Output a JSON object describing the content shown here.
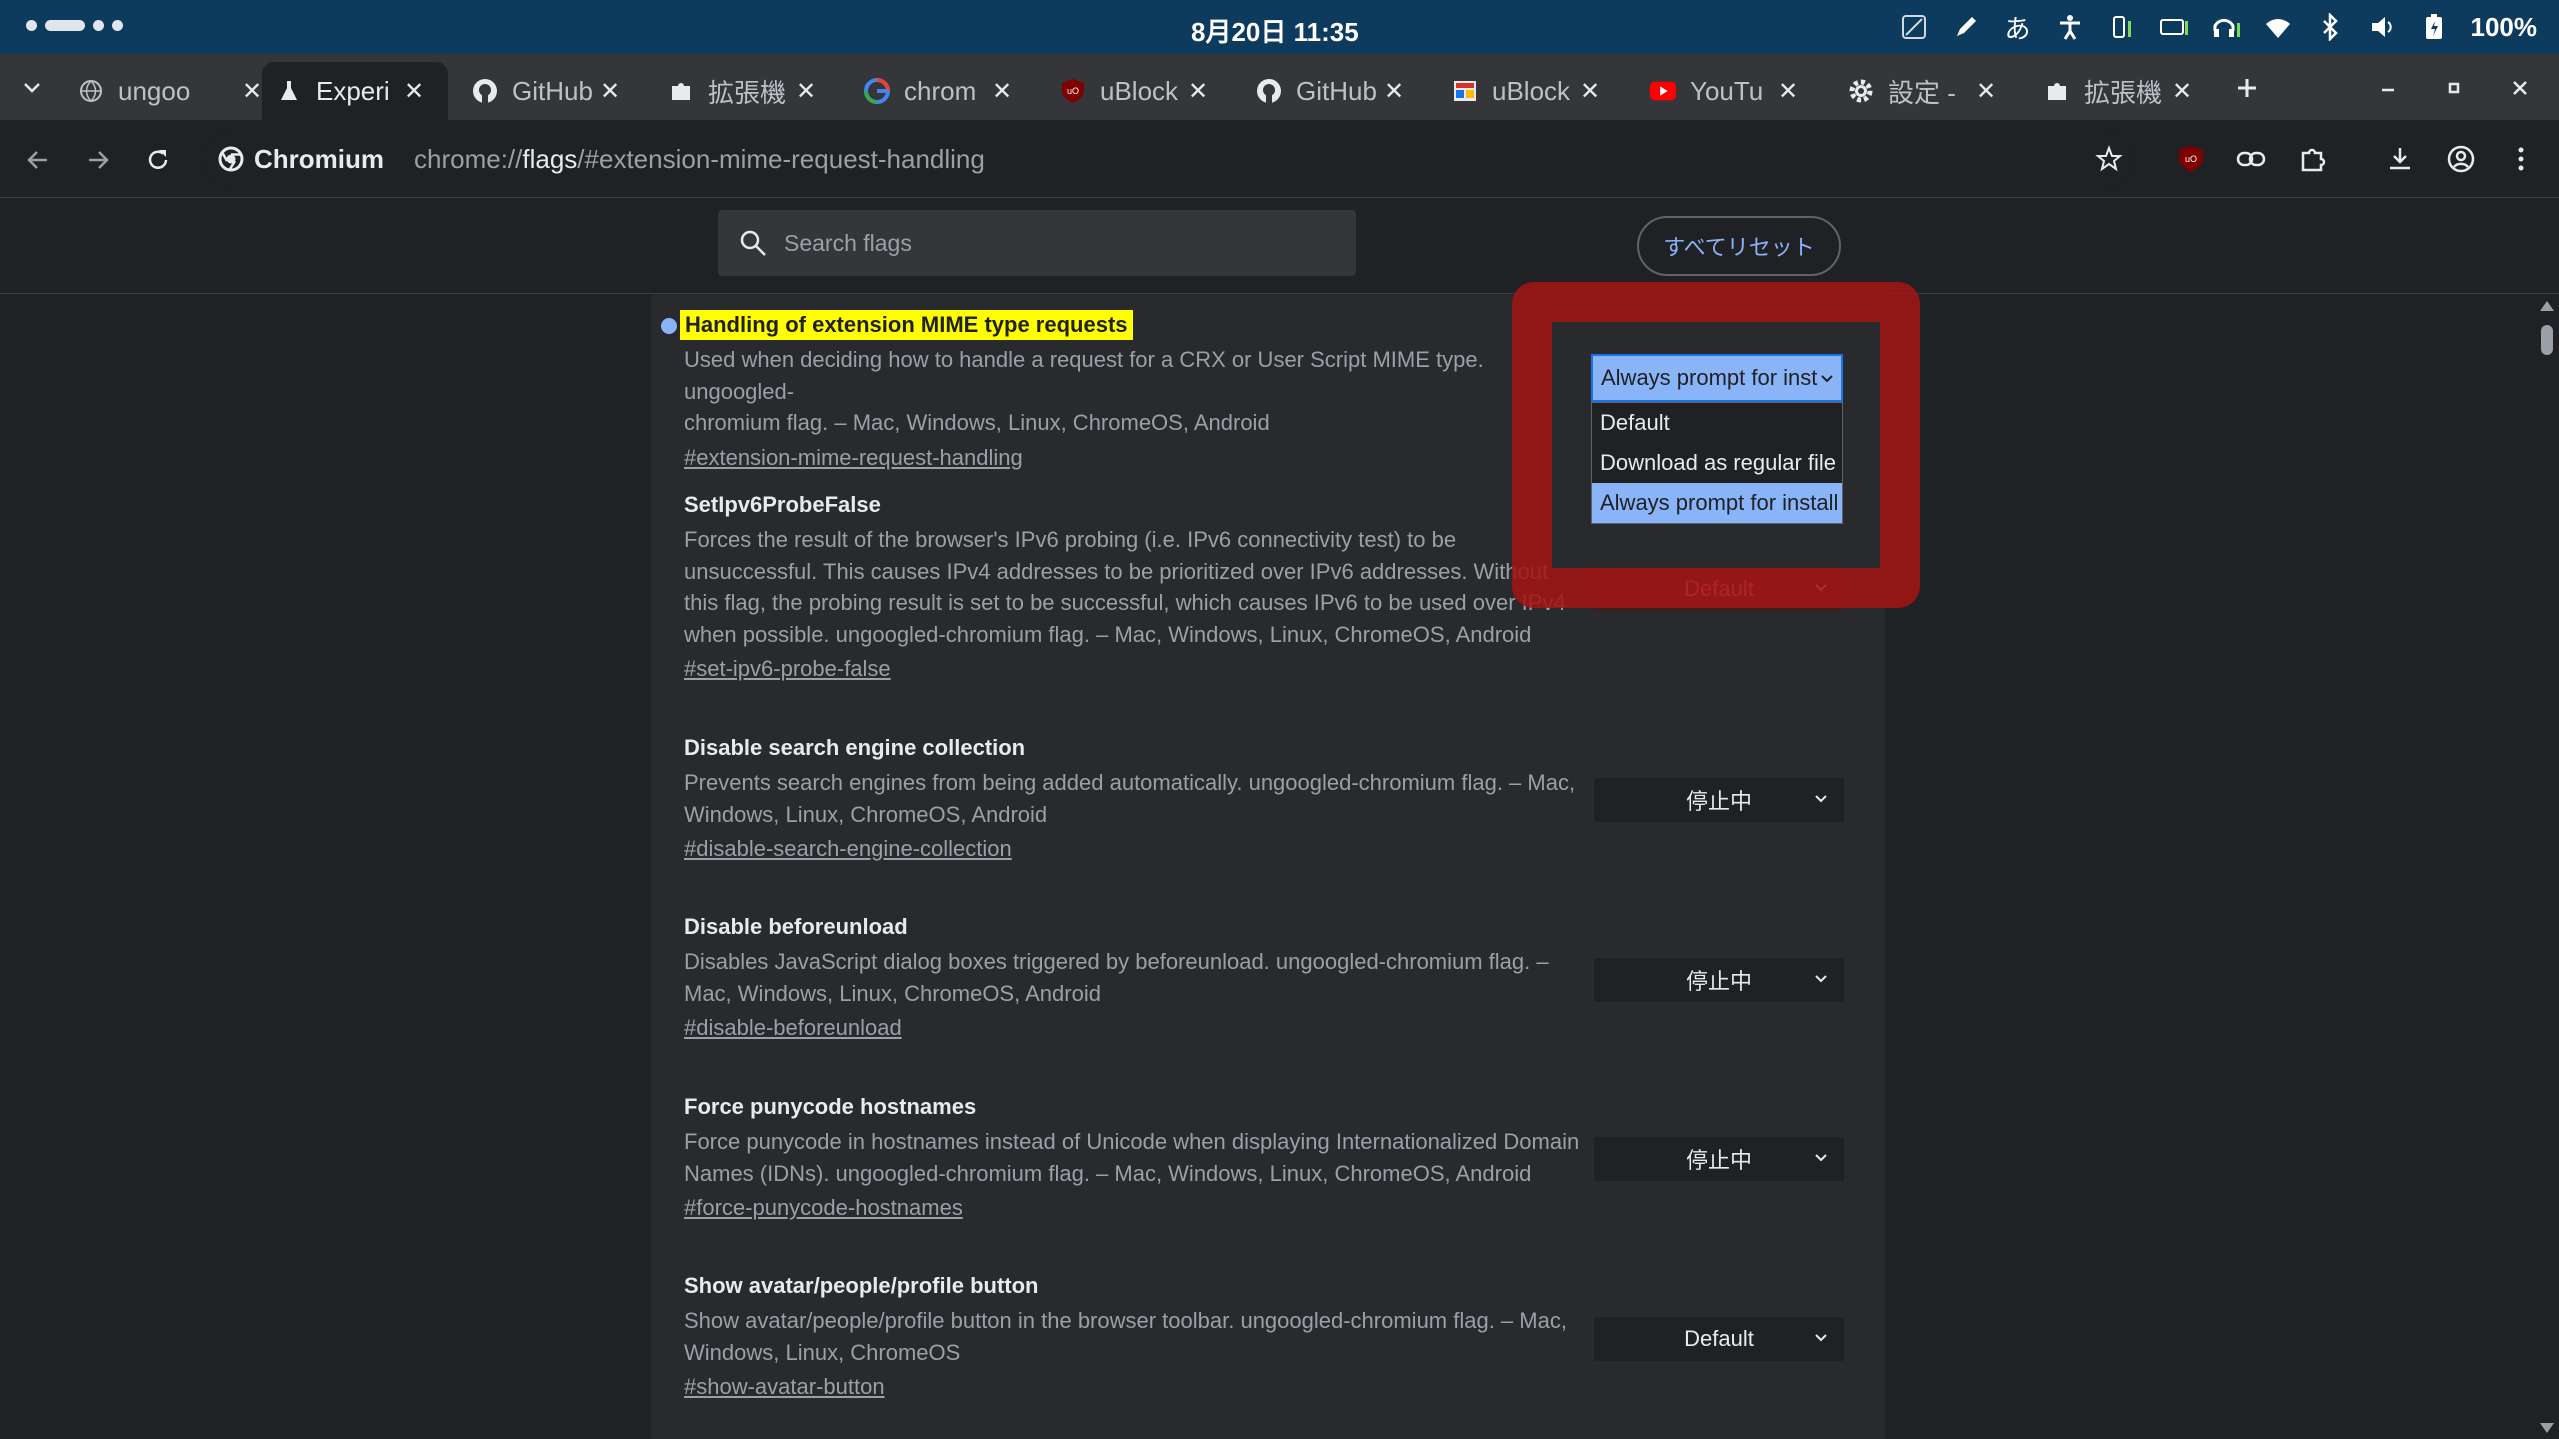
{
  "status_bar": {
    "clock": "8月20日 11:35",
    "battery": "100%",
    "ime": "あ"
  },
  "tabs": [
    {
      "title": "ungoo",
      "icon": "globe-icon"
    },
    {
      "title": "Experi",
      "icon": "flask-icon",
      "active": true
    },
    {
      "title": "GitHub",
      "icon": "github-icon"
    },
    {
      "title": "拡張機",
      "icon": "puzzle-icon"
    },
    {
      "title": "chrom",
      "icon": "google-icon"
    },
    {
      "title": "uBlock",
      "icon": "ublock-icon"
    },
    {
      "title": "GitHub",
      "icon": "github-icon"
    },
    {
      "title": "uBlock",
      "icon": "page-icon"
    },
    {
      "title": "YouTu",
      "icon": "youtube-icon"
    },
    {
      "title": "設定 -",
      "icon": "gear-icon"
    },
    {
      "title": "拡張機",
      "icon": "puzzle-icon"
    }
  ],
  "omnibox": {
    "chip": "Chromium",
    "url_prefix": "chrome://",
    "url_host": "flags",
    "url_rest": "/#extension-mime-request-handling"
  },
  "header": {
    "search_placeholder": "Search flags",
    "reset_label": "すべてリセット"
  },
  "flags": [
    {
      "title": "Handling of extension MIME type requests",
      "desc_lines": [
        "Used when deciding how to handle a request for a CRX or User Script MIME type. ungoogled-",
        "chromium flag. – Mac, Windows, Linux, ChromeOS, Android"
      ],
      "link": "#extension-mime-request-handling",
      "value": "Always prompt for inst"
    },
    {
      "title": "SetIpv6ProbeFalse",
      "desc_lines": [
        "Forces the result of the browser's IPv6 probing (i.e. IPv6 connectivity test) to be",
        "unsuccessful. This causes IPv4 addresses to be prioritized over IPv6 addresses. Without",
        "this flag, the probing result is set to be successful, which causes IPv6 to be used over IPv4",
        "when possible. ungoogled-chromium flag. – Mac, Windows, Linux, ChromeOS, Android"
      ],
      "link": "#set-ipv6-probe-false",
      "value": "Default"
    },
    {
      "title": "Disable search engine collection",
      "desc_lines": [
        "Prevents search engines from being added automatically. ungoogled-chromium flag. – Mac,",
        "Windows, Linux, ChromeOS, Android"
      ],
      "link": "#disable-search-engine-collection",
      "value": "停止中"
    },
    {
      "title": "Disable beforeunload",
      "desc_lines": [
        "Disables JavaScript dialog boxes triggered by beforeunload. ungoogled-chromium flag. –",
        "Mac, Windows, Linux, ChromeOS, Android"
      ],
      "link": "#disable-beforeunload",
      "value": "停止中"
    },
    {
      "title": "Force punycode hostnames",
      "desc_lines": [
        "Force punycode in hostnames instead of Unicode when displaying Internationalized Domain",
        "Names (IDNs). ungoogled-chromium flag. – Mac, Windows, Linux, ChromeOS, Android"
      ],
      "link": "#force-punycode-hostnames",
      "value": "停止中"
    },
    {
      "title": "Show avatar/people/profile button",
      "desc_lines": [
        "Show avatar/people/profile button in the browser toolbar. ungoogled-chromium flag. – Mac,",
        "Windows, Linux, ChromeOS"
      ],
      "link": "#show-avatar-button",
      "value": "Default"
    }
  ],
  "dropdown": {
    "current": "Always prompt for inst",
    "options": [
      "Default",
      "Download as regular file",
      "Always prompt for install"
    ],
    "selected_index": 2
  },
  "colors": {
    "highlight": "#ffff00",
    "annotation": "#a01616",
    "accent": "#8ab4f8"
  }
}
